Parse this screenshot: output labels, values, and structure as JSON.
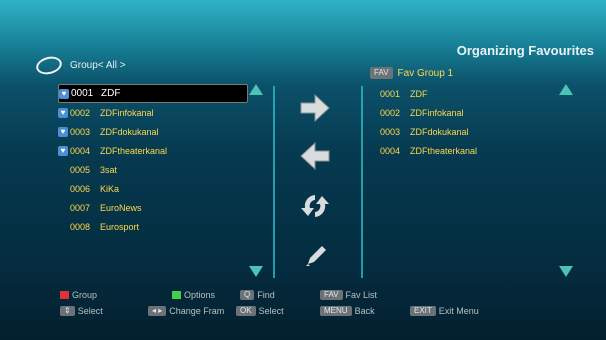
{
  "title": "Organizing Favourites",
  "left": {
    "group_label": "Group< All >",
    "channels": [
      {
        "num": "0001",
        "name": "ZDF",
        "fav": true,
        "selected": true
      },
      {
        "num": "0002",
        "name": "ZDFinfokanal",
        "fav": true,
        "selected": false
      },
      {
        "num": "0003",
        "name": "ZDFdokukanal",
        "fav": true,
        "selected": false
      },
      {
        "num": "0004",
        "name": "ZDFtheaterkanal",
        "fav": true,
        "selected": false
      },
      {
        "num": "0005",
        "name": "3sat",
        "fav": false,
        "selected": false
      },
      {
        "num": "0006",
        "name": "KiKa",
        "fav": false,
        "selected": false
      },
      {
        "num": "0007",
        "name": "EuroNews",
        "fav": false,
        "selected": false
      },
      {
        "num": "0008",
        "name": "Eurosport",
        "fav": false,
        "selected": false
      }
    ]
  },
  "right": {
    "tag": "FAV",
    "group_name": "Fav Group 1",
    "channels": [
      {
        "num": "0001",
        "name": "ZDF"
      },
      {
        "num": "0002",
        "name": "ZDFinfokanal"
      },
      {
        "num": "0003",
        "name": "ZDFdokukanal"
      },
      {
        "num": "0004",
        "name": "ZDFtheaterkanal"
      }
    ]
  },
  "footer": {
    "group": "Group",
    "options": "Options",
    "find": "Find",
    "fav_key": "FAV",
    "fav_list": "Fav List",
    "select1": "Select",
    "change_frame": "Change Fram",
    "ok_key": "OK",
    "select2": "Select",
    "menu_key": "MENU",
    "back": "Back",
    "exit_key": "EXIT",
    "exit_menu": "Exit Menu"
  },
  "colors": {
    "accent": "#2fb6c6",
    "text_yellow": "#ffd84d",
    "red": "#e0303a",
    "green": "#3fcf4f"
  }
}
